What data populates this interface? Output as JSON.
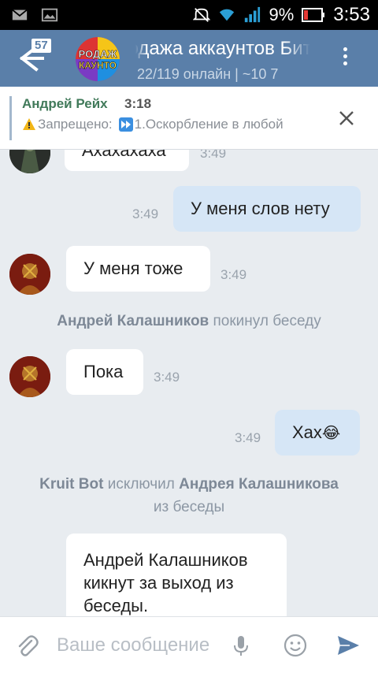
{
  "status_bar": {
    "battery_percent": "9%",
    "time": "3:53",
    "icons": [
      "mail-icon",
      "image-icon",
      "mute-icon",
      "wifi-icon",
      "signal-icon",
      "battery-icon"
    ]
  },
  "header": {
    "unread_badge": "57",
    "title": "Продажа аккаунтов Битва З",
    "subtitle": "22/119 онлайн | ~10 7",
    "avatar_text_top": "РОДАЖ",
    "avatar_text_bottom": "КАУНТО"
  },
  "pinned": {
    "author": "Андрей Рейх",
    "time": "3:18",
    "warning_label": "Запрещено:",
    "rule_text": "1.Оскорбление в любой"
  },
  "messages": [
    {
      "type": "in",
      "text": "Ахахахаха",
      "time": "3:49"
    },
    {
      "type": "out",
      "text": "У меня слов нету",
      "time": "3:49"
    },
    {
      "type": "in",
      "text": "У меня тоже",
      "time": "3:49"
    },
    {
      "type": "service",
      "actor": "Андрей Калашников",
      "text": "покинул беседу"
    },
    {
      "type": "in",
      "text": "Пока",
      "time": "3:49"
    },
    {
      "type": "out",
      "text": "Хах",
      "emoji": "😂",
      "time": "3:49"
    },
    {
      "type": "service",
      "actor": "Kruit Bot",
      "text": "исключил",
      "target": "Андрея Калашникова",
      "tail": "из беседы"
    },
    {
      "type": "in",
      "text_lines": [
        "Андрей Калашников",
        "кикнут за выход из",
        "беседы."
      ]
    }
  ],
  "input": {
    "placeholder": "Ваше сообщение"
  },
  "colors": {
    "header_bg": "#5a7fa9",
    "chat_bg": "#e8ecf0",
    "outgoing_bubble": "#d6e6f6",
    "incoming_bubble": "#ffffff",
    "pinned_author": "#417a5a",
    "send_icon": "#5a7fa9"
  }
}
